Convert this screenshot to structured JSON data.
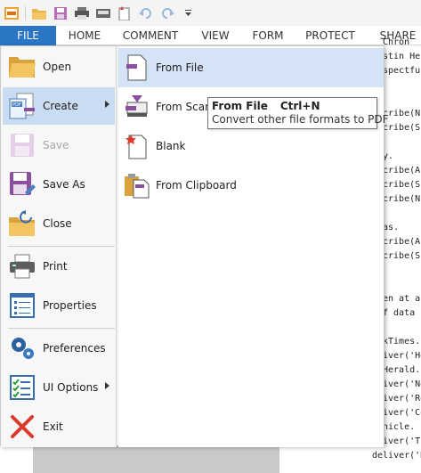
{
  "ribbon": {
    "tabs": [
      "FILE",
      "HOME",
      "COMMENT",
      "VIEW",
      "FORM",
      "PROTECT",
      "SHARE"
    ]
  },
  "code_lines": [
    "Chron",
    "stin He",
    "spectfu",
    "cribe(N",
    "cribe(S",
    "y.",
    "cribe(A",
    "cribe(S",
    "cribe(N",
    "as.",
    "cribe(A",
    "cribe(S",
    "en at a",
    "f data",
    "kTimes.",
    "iver('He",
    "Herald.",
    "iver('Ne",
    "iver('Re",
    "iver('Co",
    "nicle.",
    "iver('Th",
    "deliver('Hi"
  ],
  "file_menu": {
    "items": [
      {
        "label": "Open",
        "icon": "open-folder-icon"
      },
      {
        "label": "Create",
        "icon": "create-pdf-icon",
        "has_submenu": true,
        "selected": true
      },
      {
        "label": "Save",
        "icon": "save-icon",
        "disabled": true
      },
      {
        "label": "Save As",
        "icon": "save-as-icon"
      },
      {
        "label": "Close",
        "icon": "close-folder-icon"
      },
      {
        "label": "Print",
        "icon": "printer-icon"
      },
      {
        "label": "Properties",
        "icon": "properties-icon"
      },
      {
        "label": "Preferences",
        "icon": "gears-icon"
      },
      {
        "label": "UI Options",
        "icon": "checklist-icon",
        "has_submenu": true
      },
      {
        "label": "Exit",
        "icon": "exit-x-icon"
      }
    ],
    "create_submenu": [
      {
        "label": "From File",
        "icon": "from-file-icon",
        "hover": true
      },
      {
        "label": "From Scanner",
        "icon": "from-scanner-icon"
      },
      {
        "label": "Blank",
        "icon": "blank-page-icon"
      },
      {
        "label": "From Clipboard",
        "icon": "from-clipboard-icon"
      }
    ]
  },
  "tooltip": {
    "title": "From File",
    "shortcut": "Ctrl+N",
    "description": "Convert other file formats to PDF"
  },
  "colors": {
    "accent": "#2a75c4",
    "selected_bg": "#c9dcf1",
    "hover_bg": "#d4e3f5"
  }
}
